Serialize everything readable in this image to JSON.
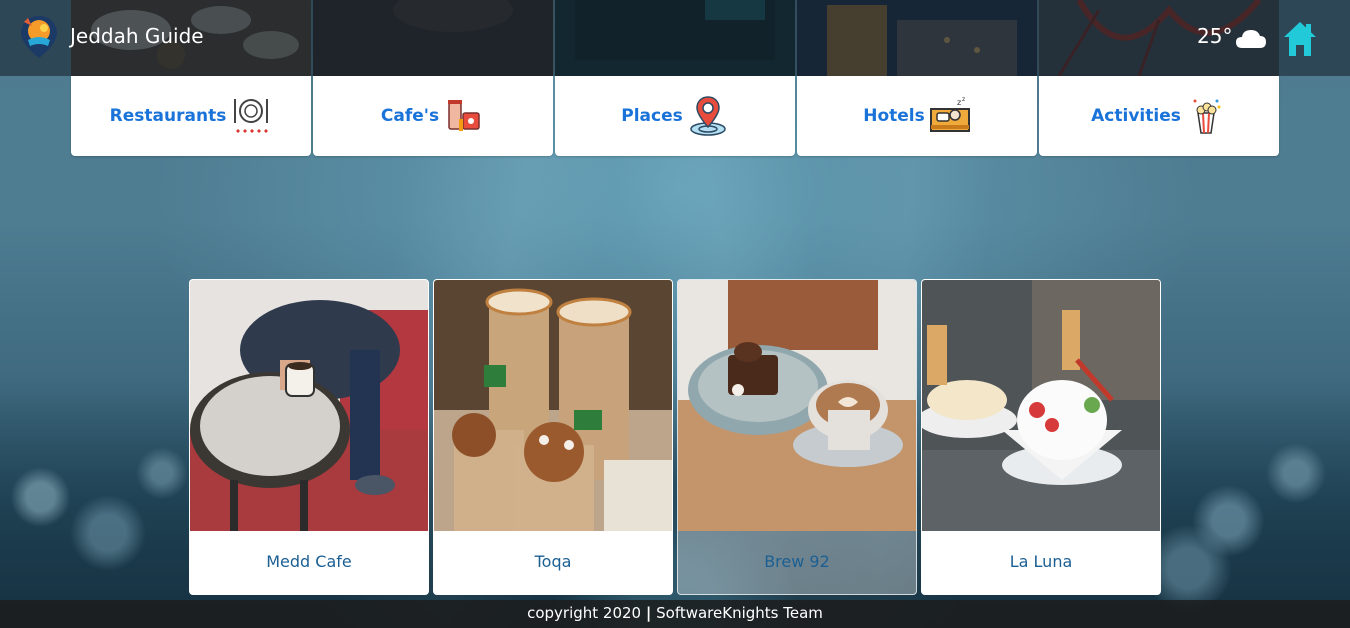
{
  "header": {
    "brand": "Jeddah Guide",
    "temperature": "25°",
    "weather_icon": "cloud-icon",
    "home_icon": "home-icon"
  },
  "categories": [
    {
      "label": "Restaurants",
      "icon": "restaurant-icon"
    },
    {
      "label": "Cafe's",
      "icon": "cafe-icon"
    },
    {
      "label": "Places",
      "icon": "location-pin-icon"
    },
    {
      "label": "Hotels",
      "icon": "hotel-bed-icon"
    },
    {
      "label": "Activities",
      "icon": "popcorn-icon"
    }
  ],
  "places": [
    {
      "name": "Medd Cafe"
    },
    {
      "name": "Toqa"
    },
    {
      "name": "Brew 92"
    },
    {
      "name": "La Luna"
    }
  ],
  "footer": {
    "text_before": "copyright 2020 ",
    "separator": "|",
    "text_after": " SoftwareKnights Team"
  },
  "colors": {
    "category_label": "#1a73d9",
    "place_name": "#1b5f93",
    "home_icon": "#22c9d9"
  }
}
